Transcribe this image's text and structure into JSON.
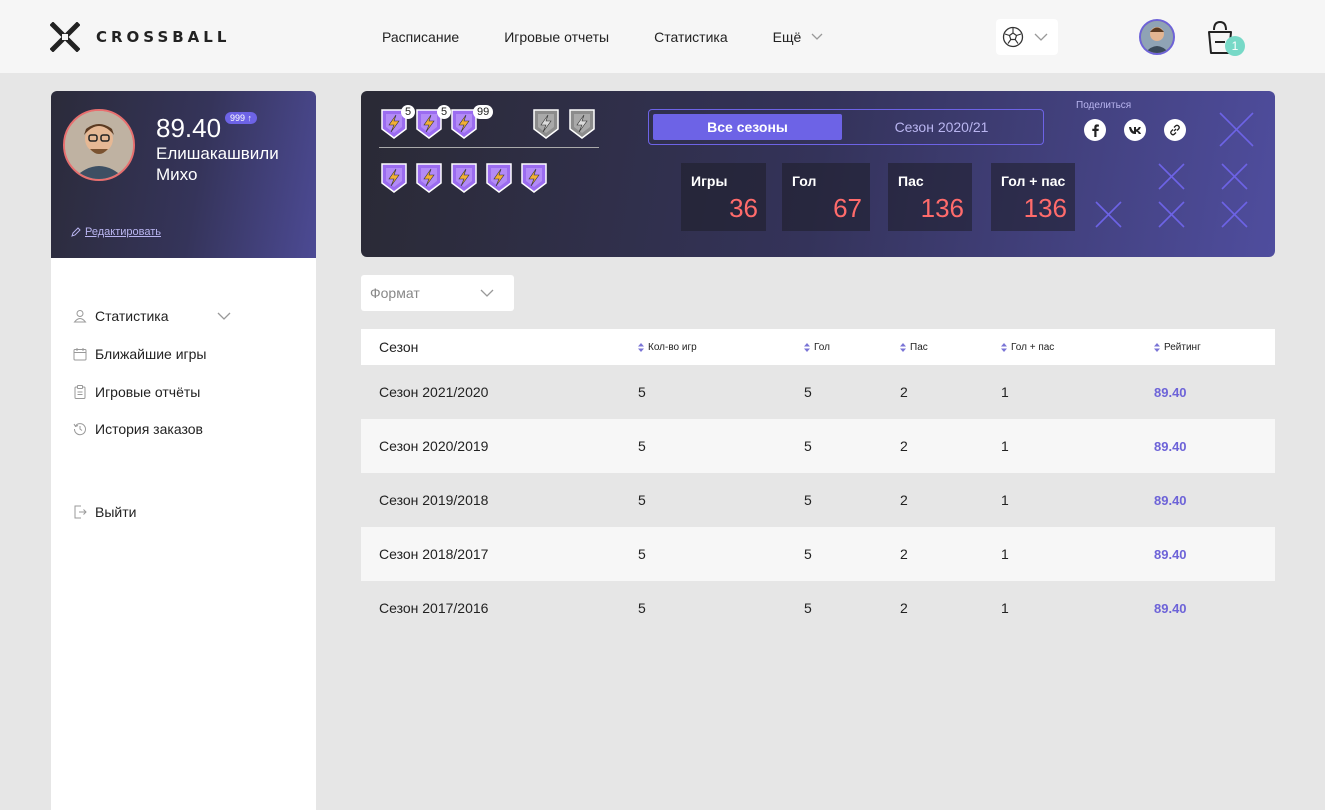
{
  "brand": {
    "name": "CROSSBALL"
  },
  "nav": {
    "items": [
      "Расписание",
      "Игровые отчеты",
      "Статистика"
    ],
    "more_label": "Ещё"
  },
  "header": {
    "sport_icon": "soccer-ball-icon",
    "cart_count": "1"
  },
  "profile": {
    "rating": "89.40",
    "rating_badge": "999 ↑",
    "name": "Елишакашвили Михо",
    "edit_label": "Редактировать"
  },
  "sidebar": {
    "items": [
      {
        "label": "Статистика",
        "icon": "user-icon"
      },
      {
        "label": "Ближайшие игры",
        "icon": "calendar-icon"
      },
      {
        "label": "Игровые отчёты",
        "icon": "clipboard-icon"
      },
      {
        "label": "История заказов",
        "icon": "history-icon"
      }
    ],
    "logout_label": "Выйти"
  },
  "badges": {
    "counts": [
      "5",
      "5",
      "99"
    ]
  },
  "seasons": {
    "active": "Все сезоны",
    "inactive": "Сезон 2020/21"
  },
  "share": {
    "label": "Поделиться",
    "icons": [
      "facebook-icon",
      "vk-icon",
      "link-icon"
    ]
  },
  "stats": [
    {
      "label": "Игры",
      "value": "36"
    },
    {
      "label": "Гол",
      "value": "67"
    },
    {
      "label": "Пас",
      "value": "136"
    },
    {
      "label": "Гол + пас",
      "value": "136"
    }
  ],
  "filter": {
    "format_placeholder": "Формат"
  },
  "table": {
    "headers": [
      "Сезон",
      "Кол-во игр",
      "Гол",
      "Пас",
      "Гол + пас",
      "Рейтинг"
    ],
    "rows": [
      [
        "Сезон 2021/2020",
        "5",
        "5",
        "2",
        "1",
        "89.40"
      ],
      [
        "Сезон 2020/2019",
        "5",
        "5",
        "2",
        "1",
        "89.40"
      ],
      [
        "Сезон 2019/2018",
        "5",
        "5",
        "2",
        "1",
        "89.40"
      ],
      [
        "Сезон 2018/2017",
        "5",
        "5",
        "2",
        "1",
        "89.40"
      ],
      [
        "Сезон 2017/2016",
        "5",
        "5",
        "2",
        "1",
        "89.40"
      ]
    ]
  },
  "colors": {
    "accent": "#6d63e6",
    "stat_value": "#ff6b6b",
    "cart_badge": "#77d9c7"
  }
}
